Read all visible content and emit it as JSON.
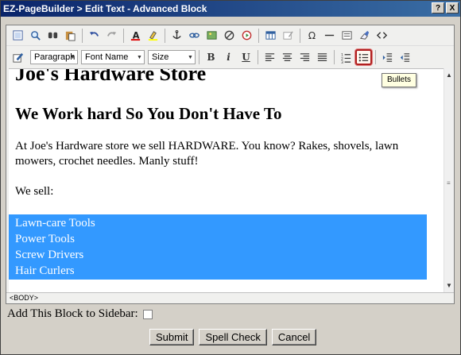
{
  "window": {
    "title": "EZ-PageBuilder > Edit Text - Advanced Block",
    "help_label": "?",
    "close_label": "X"
  },
  "toolbar": {
    "paragraph_select": "Paragraph",
    "font_select": "Font Name",
    "size_select": "Size",
    "bold_label": "B",
    "italic_label": "i",
    "underline_label": "U",
    "omega_label": "Ω"
  },
  "tooltip": "Bullets",
  "document": {
    "heading1": "Joe's Hardware Store",
    "heading2": "We Work hard So You Don't Have To",
    "paragraph": "At Joe's Hardware store we sell HARDWARE.  You know?  Rakes, shovels, lawn mowers, crochet needles. Manly stuff!",
    "we_sell": "We sell:",
    "list_items": [
      "Lawn-care Tools",
      "Power Tools",
      "Screw Drivers",
      "Hair Curlers"
    ],
    "selection_color": "#3399ff"
  },
  "statusbar": {
    "path": "<BODY>"
  },
  "form": {
    "sidebar_label": "Add This Block to Sidebar:",
    "submit_label": "Submit",
    "spellcheck_label": "Spell Check",
    "cancel_label": "Cancel"
  },
  "colors": {
    "title_gradient_start": "#0a246a",
    "highlight_border": "#b02020"
  }
}
